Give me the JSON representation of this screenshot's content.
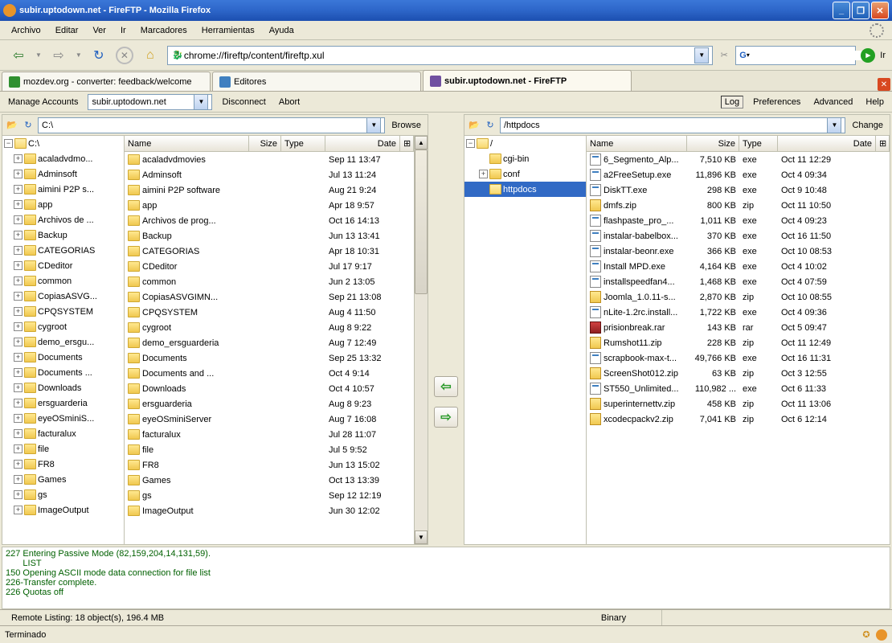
{
  "window": {
    "title": "subir.uptodown.net - FireFTP - Mozilla Firefox"
  },
  "menubar": [
    "Archivo",
    "Editar",
    "Ver",
    "Ir",
    "Marcadores",
    "Herramientas",
    "Ayuda"
  ],
  "url": "chrome://fireftp/content/fireftp.xul",
  "go_label": "Ir",
  "tabs": [
    {
      "label": "mozdev.org - converter: feedback/welcome"
    },
    {
      "label": "Editores"
    },
    {
      "label": "subir.uptodown.net - FireFTP"
    }
  ],
  "ftp": {
    "manage": "Manage Accounts",
    "account": "subir.uptodown.net",
    "disconnect": "Disconnect",
    "abort": "Abort",
    "log": "Log",
    "prefs": "Preferences",
    "advanced": "Advanced",
    "help": "Help"
  },
  "local": {
    "path": "C:\\",
    "browse": "Browse",
    "headers": {
      "name": "Name",
      "size": "Size",
      "type": "Type",
      "date": "Date"
    },
    "tree_root": "C:\\",
    "tree": [
      "acaladvdmo...",
      "Adminsoft",
      "aimini P2P s...",
      "app",
      "Archivos de ...",
      "Backup",
      "CATEGORIAS",
      "CDeditor",
      "common",
      "CopiasASVG...",
      "CPQSYSTEM",
      "cygroot",
      "demo_ersgu...",
      "Documents",
      "Documents ...",
      "Downloads",
      "ersguarderia",
      "eyeOSminiS...",
      "facturalux",
      "file",
      "FR8",
      "Games",
      "gs",
      "ImageOutput"
    ],
    "files": [
      {
        "n": "acaladvdmovies",
        "d": "Sep 11 13:47"
      },
      {
        "n": "Adminsoft",
        "d": "Jul 13 11:24"
      },
      {
        "n": "aimini P2P software",
        "d": "Aug 21 9:24"
      },
      {
        "n": "app",
        "d": "Apr 18 9:57"
      },
      {
        "n": "Archivos de prog...",
        "d": "Oct 16 14:13"
      },
      {
        "n": "Backup",
        "d": "Jun 13 13:41"
      },
      {
        "n": "CATEGORIAS",
        "d": "Apr 18 10:31"
      },
      {
        "n": "CDeditor",
        "d": "Jul 17 9:17"
      },
      {
        "n": "common",
        "d": "Jun 2 13:05"
      },
      {
        "n": "CopiasASVGIMN...",
        "d": "Sep 21 13:08"
      },
      {
        "n": "CPQSYSTEM",
        "d": "Aug 4 11:50"
      },
      {
        "n": "cygroot",
        "d": "Aug 8 9:22"
      },
      {
        "n": "demo_ersguarderia",
        "d": "Aug 7 12:49"
      },
      {
        "n": "Documents",
        "d": "Sep 25 13:32"
      },
      {
        "n": "Documents and ...",
        "d": "Oct 4 9:14"
      },
      {
        "n": "Downloads",
        "d": "Oct 4 10:57"
      },
      {
        "n": "ersguarderia",
        "d": "Aug 8 9:23"
      },
      {
        "n": "eyeOSminiServer",
        "d": "Aug 7 16:08"
      },
      {
        "n": "facturalux",
        "d": "Jul 28 11:07"
      },
      {
        "n": "file",
        "d": "Jul 5 9:52"
      },
      {
        "n": "FR8",
        "d": "Jun 13 15:02"
      },
      {
        "n": "Games",
        "d": "Oct 13 13:39"
      },
      {
        "n": "gs",
        "d": "Sep 12 12:19"
      },
      {
        "n": "ImageOutput",
        "d": "Jun 30 12:02"
      }
    ]
  },
  "remote": {
    "path": "/httpdocs",
    "change": "Change",
    "headers": {
      "name": "Name",
      "size": "Size",
      "type": "Type",
      "date": "Date"
    },
    "tree_root": "/",
    "tree": [
      {
        "n": "cgi-bin",
        "exp": false
      },
      {
        "n": "conf",
        "exp": true
      },
      {
        "n": "httpdocs",
        "sel": true
      }
    ],
    "files": [
      {
        "n": "6_Segmento_Alp...",
        "s": "7,510 KB",
        "t": "exe",
        "d": "Oct 11 12:29",
        "i": "exe"
      },
      {
        "n": "a2FreeSetup.exe",
        "s": "11,896 KB",
        "t": "exe",
        "d": "Oct 4 09:34",
        "i": "exe"
      },
      {
        "n": "DiskTT.exe",
        "s": "298 KB",
        "t": "exe",
        "d": "Oct 9 10:48",
        "i": "exe"
      },
      {
        "n": "dmfs.zip",
        "s": "800 KB",
        "t": "zip",
        "d": "Oct 11 10:50",
        "i": "zip"
      },
      {
        "n": "flashpaste_pro_...",
        "s": "1,011 KB",
        "t": "exe",
        "d": "Oct 4 09:23",
        "i": "exe"
      },
      {
        "n": "instalar-babelbox...",
        "s": "370 KB",
        "t": "exe",
        "d": "Oct 16 11:50",
        "i": "exe"
      },
      {
        "n": "instalar-beonr.exe",
        "s": "366 KB",
        "t": "exe",
        "d": "Oct 10 08:53",
        "i": "exe"
      },
      {
        "n": "Install MPD.exe",
        "s": "4,164 KB",
        "t": "exe",
        "d": "Oct 4 10:02",
        "i": "exe"
      },
      {
        "n": "installspeedfan4...",
        "s": "1,468 KB",
        "t": "exe",
        "d": "Oct 4 07:59",
        "i": "exe"
      },
      {
        "n": "Joomla_1.0.11-s...",
        "s": "2,870 KB",
        "t": "zip",
        "d": "Oct 10 08:55",
        "i": "zip"
      },
      {
        "n": "nLite-1.2rc.install...",
        "s": "1,722 KB",
        "t": "exe",
        "d": "Oct 4 09:36",
        "i": "exe"
      },
      {
        "n": "prisionbreak.rar",
        "s": "143 KB",
        "t": "rar",
        "d": "Oct 5 09:47",
        "i": "rar"
      },
      {
        "n": "Rumshot11.zip",
        "s": "228 KB",
        "t": "zip",
        "d": "Oct 11 12:49",
        "i": "zip"
      },
      {
        "n": "scrapbook-max-t...",
        "s": "49,766 KB",
        "t": "exe",
        "d": "Oct 16 11:31",
        "i": "exe"
      },
      {
        "n": "ScreenShot012.zip",
        "s": "63 KB",
        "t": "zip",
        "d": "Oct 3 12:55",
        "i": "zip"
      },
      {
        "n": "ST550_Unlimited...",
        "s": "110,982 ...",
        "t": "exe",
        "d": "Oct 6 11:33",
        "i": "exe"
      },
      {
        "n": "superinternettv.zip",
        "s": "458 KB",
        "t": "zip",
        "d": "Oct 11 13:06",
        "i": "zip"
      },
      {
        "n": "xcodecpackv2.zip",
        "s": "7,041 KB",
        "t": "zip",
        "d": "Oct 6 12:14",
        "i": "zip"
      }
    ]
  },
  "log": [
    "227 Entering Passive Mode (82,159,204,14,131,59).",
    "       LIST",
    "150 Opening ASCII mode data connection for file list",
    "226-Transfer complete.",
    "226 Quotas off"
  ],
  "status": {
    "listing": "Remote Listing: 18 object(s), 196.4 MB",
    "mode": "Binary"
  },
  "ff_status": "Terminado"
}
